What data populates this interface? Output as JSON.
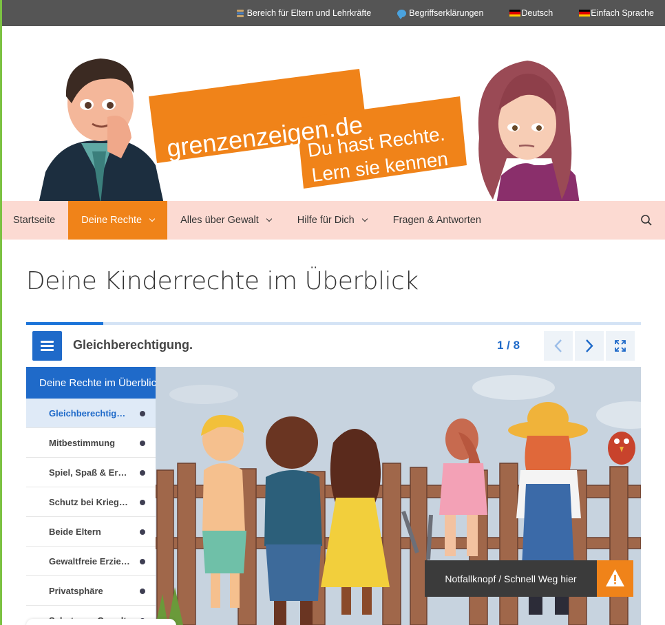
{
  "colors": {
    "orange": "#f08319",
    "blue": "#1f6ac9",
    "nav_bg": "#fcdad2",
    "topbar_bg": "#555555"
  },
  "topbar": {
    "links": [
      {
        "icon": "books-icon",
        "label": "Bereich für Eltern und Lehrkräfte"
      },
      {
        "icon": "speech-bubble-icon",
        "label": "Begriffserklärungen"
      },
      {
        "icon": "german-flag-icon",
        "label": "Deutsch"
      },
      {
        "icon": "german-flag-icon",
        "label": "Einfach Sprache"
      }
    ]
  },
  "logo": {
    "site": "grenzenzeigen.de",
    "tagline_1": "Du hast Rechte.",
    "tagline_2": "Lern sie kennen"
  },
  "nav": {
    "items": [
      {
        "label": "Startseite",
        "dropdown": false,
        "active": false
      },
      {
        "label": "Deine Rechte",
        "dropdown": true,
        "active": true
      },
      {
        "label": "Alles über Gewalt",
        "dropdown": true,
        "active": false
      },
      {
        "label": "Hilfe für Dich",
        "dropdown": true,
        "active": false
      },
      {
        "label": "Fragen & Antworten",
        "dropdown": false,
        "active": false
      }
    ],
    "search_icon": "search-icon"
  },
  "page": {
    "title": "Deine Kinderrechte im Überblick"
  },
  "presentation": {
    "progress": 0.125,
    "slide_title": "Gleichberechtigung.",
    "counter": "1 / 8",
    "sidebar_heading": "Deine Rechte im Überblick",
    "items": [
      {
        "label": "Gleichberechtigung",
        "active": true
      },
      {
        "label": "Mitbestimmung",
        "active": false
      },
      {
        "label": "Spiel, Spaß & Erholung",
        "active": false
      },
      {
        "label": "Schutz bei Krieg und Flucht",
        "active": false
      },
      {
        "label": "Beide Eltern",
        "active": false
      },
      {
        "label": "Gewaltfreie Erziehung",
        "active": false
      },
      {
        "label": "Privatsphäre",
        "active": false
      },
      {
        "label": "Schutz vor Gewalt",
        "active": false
      }
    ]
  },
  "emergency": {
    "label": "Notfallknopf / Schnell Weg hier",
    "icon": "warning-icon"
  }
}
